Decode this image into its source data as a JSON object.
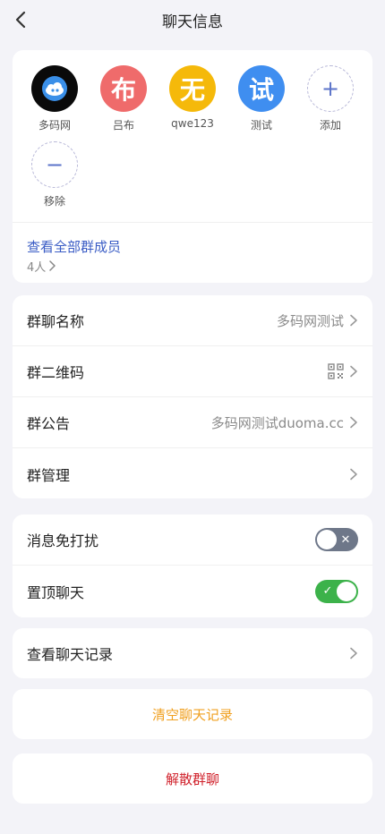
{
  "header": {
    "title": "聊天信息",
    "back_icon": "chevron-left-icon"
  },
  "members": [
    {
      "name": "多码网",
      "avatar_char": "",
      "avatar_color": "#0a0a0a",
      "avatar_icon": "cloud-logo-icon"
    },
    {
      "name": "吕布",
      "avatar_char": "布",
      "avatar_color": "#ef6b6b"
    },
    {
      "name": "qwe123",
      "avatar_char": "无",
      "avatar_color": "#f5b90a"
    },
    {
      "name": "测试",
      "avatar_char": "试",
      "avatar_color": "#3f8ef0"
    }
  ],
  "add_member": {
    "symbol": "+",
    "label": "添加"
  },
  "remove_member": {
    "symbol": "−",
    "label": "移除"
  },
  "members_footer": {
    "view_all": "查看全部群成员",
    "count": "4人"
  },
  "group_info": {
    "name_label": "群聊名称",
    "name_value": "多码网测试",
    "qrcode_label": "群二维码",
    "qrcode_icon": "qrcode-icon",
    "notice_label": "群公告",
    "notice_value": "多码网测试duoma.cc",
    "manage_label": "群管理"
  },
  "toggles": {
    "mute_label": "消息免打扰",
    "mute_on": false,
    "pin_label": "置顶聊天",
    "pin_on": true
  },
  "history": {
    "label": "查看聊天记录"
  },
  "clear": {
    "label": "清空聊天记录",
    "color": "#f0a020"
  },
  "dissolve": {
    "label": "解散群聊",
    "color": "#d0202a"
  }
}
